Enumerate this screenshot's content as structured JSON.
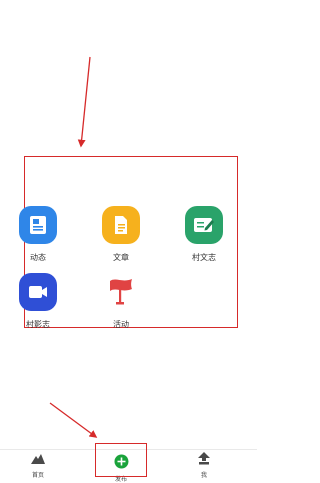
{
  "grid": {
    "items": [
      {
        "label": "动态",
        "icon": "document-note-icon",
        "color": "#2f86e8"
      },
      {
        "label": "文章",
        "icon": "file-icon",
        "color": "#f6b11d"
      },
      {
        "label": "村文志",
        "icon": "edit-notes-icon",
        "color": "#2aa36a"
      },
      {
        "label": "村影志",
        "icon": "video-camera-icon",
        "color": "#2f4fd6"
      },
      {
        "label": "活动",
        "icon": "flag-icon",
        "color": "#e04343"
      }
    ]
  },
  "tabbar": {
    "tabs": [
      {
        "label": "首页",
        "icon": "mountain-home-icon"
      },
      {
        "label": "发布",
        "icon": "plus-circle-icon",
        "color": "#1aa33b"
      },
      {
        "label": "我",
        "icon": "upload-person-icon"
      }
    ]
  },
  "colors": {
    "annotation": "#d62a2a"
  }
}
